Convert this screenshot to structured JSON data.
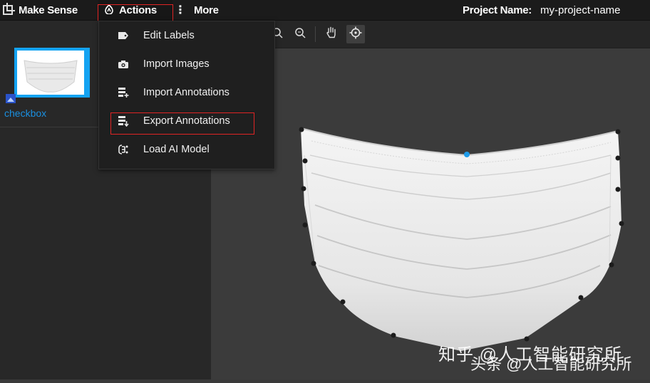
{
  "topbar": {
    "brand": "Make Sense",
    "actions_label": "Actions",
    "more_label": "More",
    "project_label": "Project Name:",
    "project_value": "my-project-name"
  },
  "sidebar": {
    "image_name": "checkbox"
  },
  "actions_menu": {
    "items": [
      {
        "label": "Edit Labels",
        "icon": "label-tag-icon"
      },
      {
        "label": "Import Images",
        "icon": "camera-icon"
      },
      {
        "label": "Import Annotations",
        "icon": "import-list-icon"
      },
      {
        "label": "Export Annotations",
        "icon": "export-list-icon"
      },
      {
        "label": "Load AI Model",
        "icon": "ai-chip-icon"
      }
    ]
  },
  "toolbar": {
    "tools": [
      "zoom-in-icon",
      "zoom-fit-icon",
      "pan-hand-icon",
      "crosshair-icon"
    ]
  },
  "watermark": {
    "line1": "知乎 @人工智能研究所",
    "line2": "头条 @人工智能研究所"
  },
  "colors": {
    "accent": "#14a3f2",
    "highlight_box": "#e02424",
    "polygon_point": "#1c1c1c",
    "active_point": "#1e9be9"
  }
}
